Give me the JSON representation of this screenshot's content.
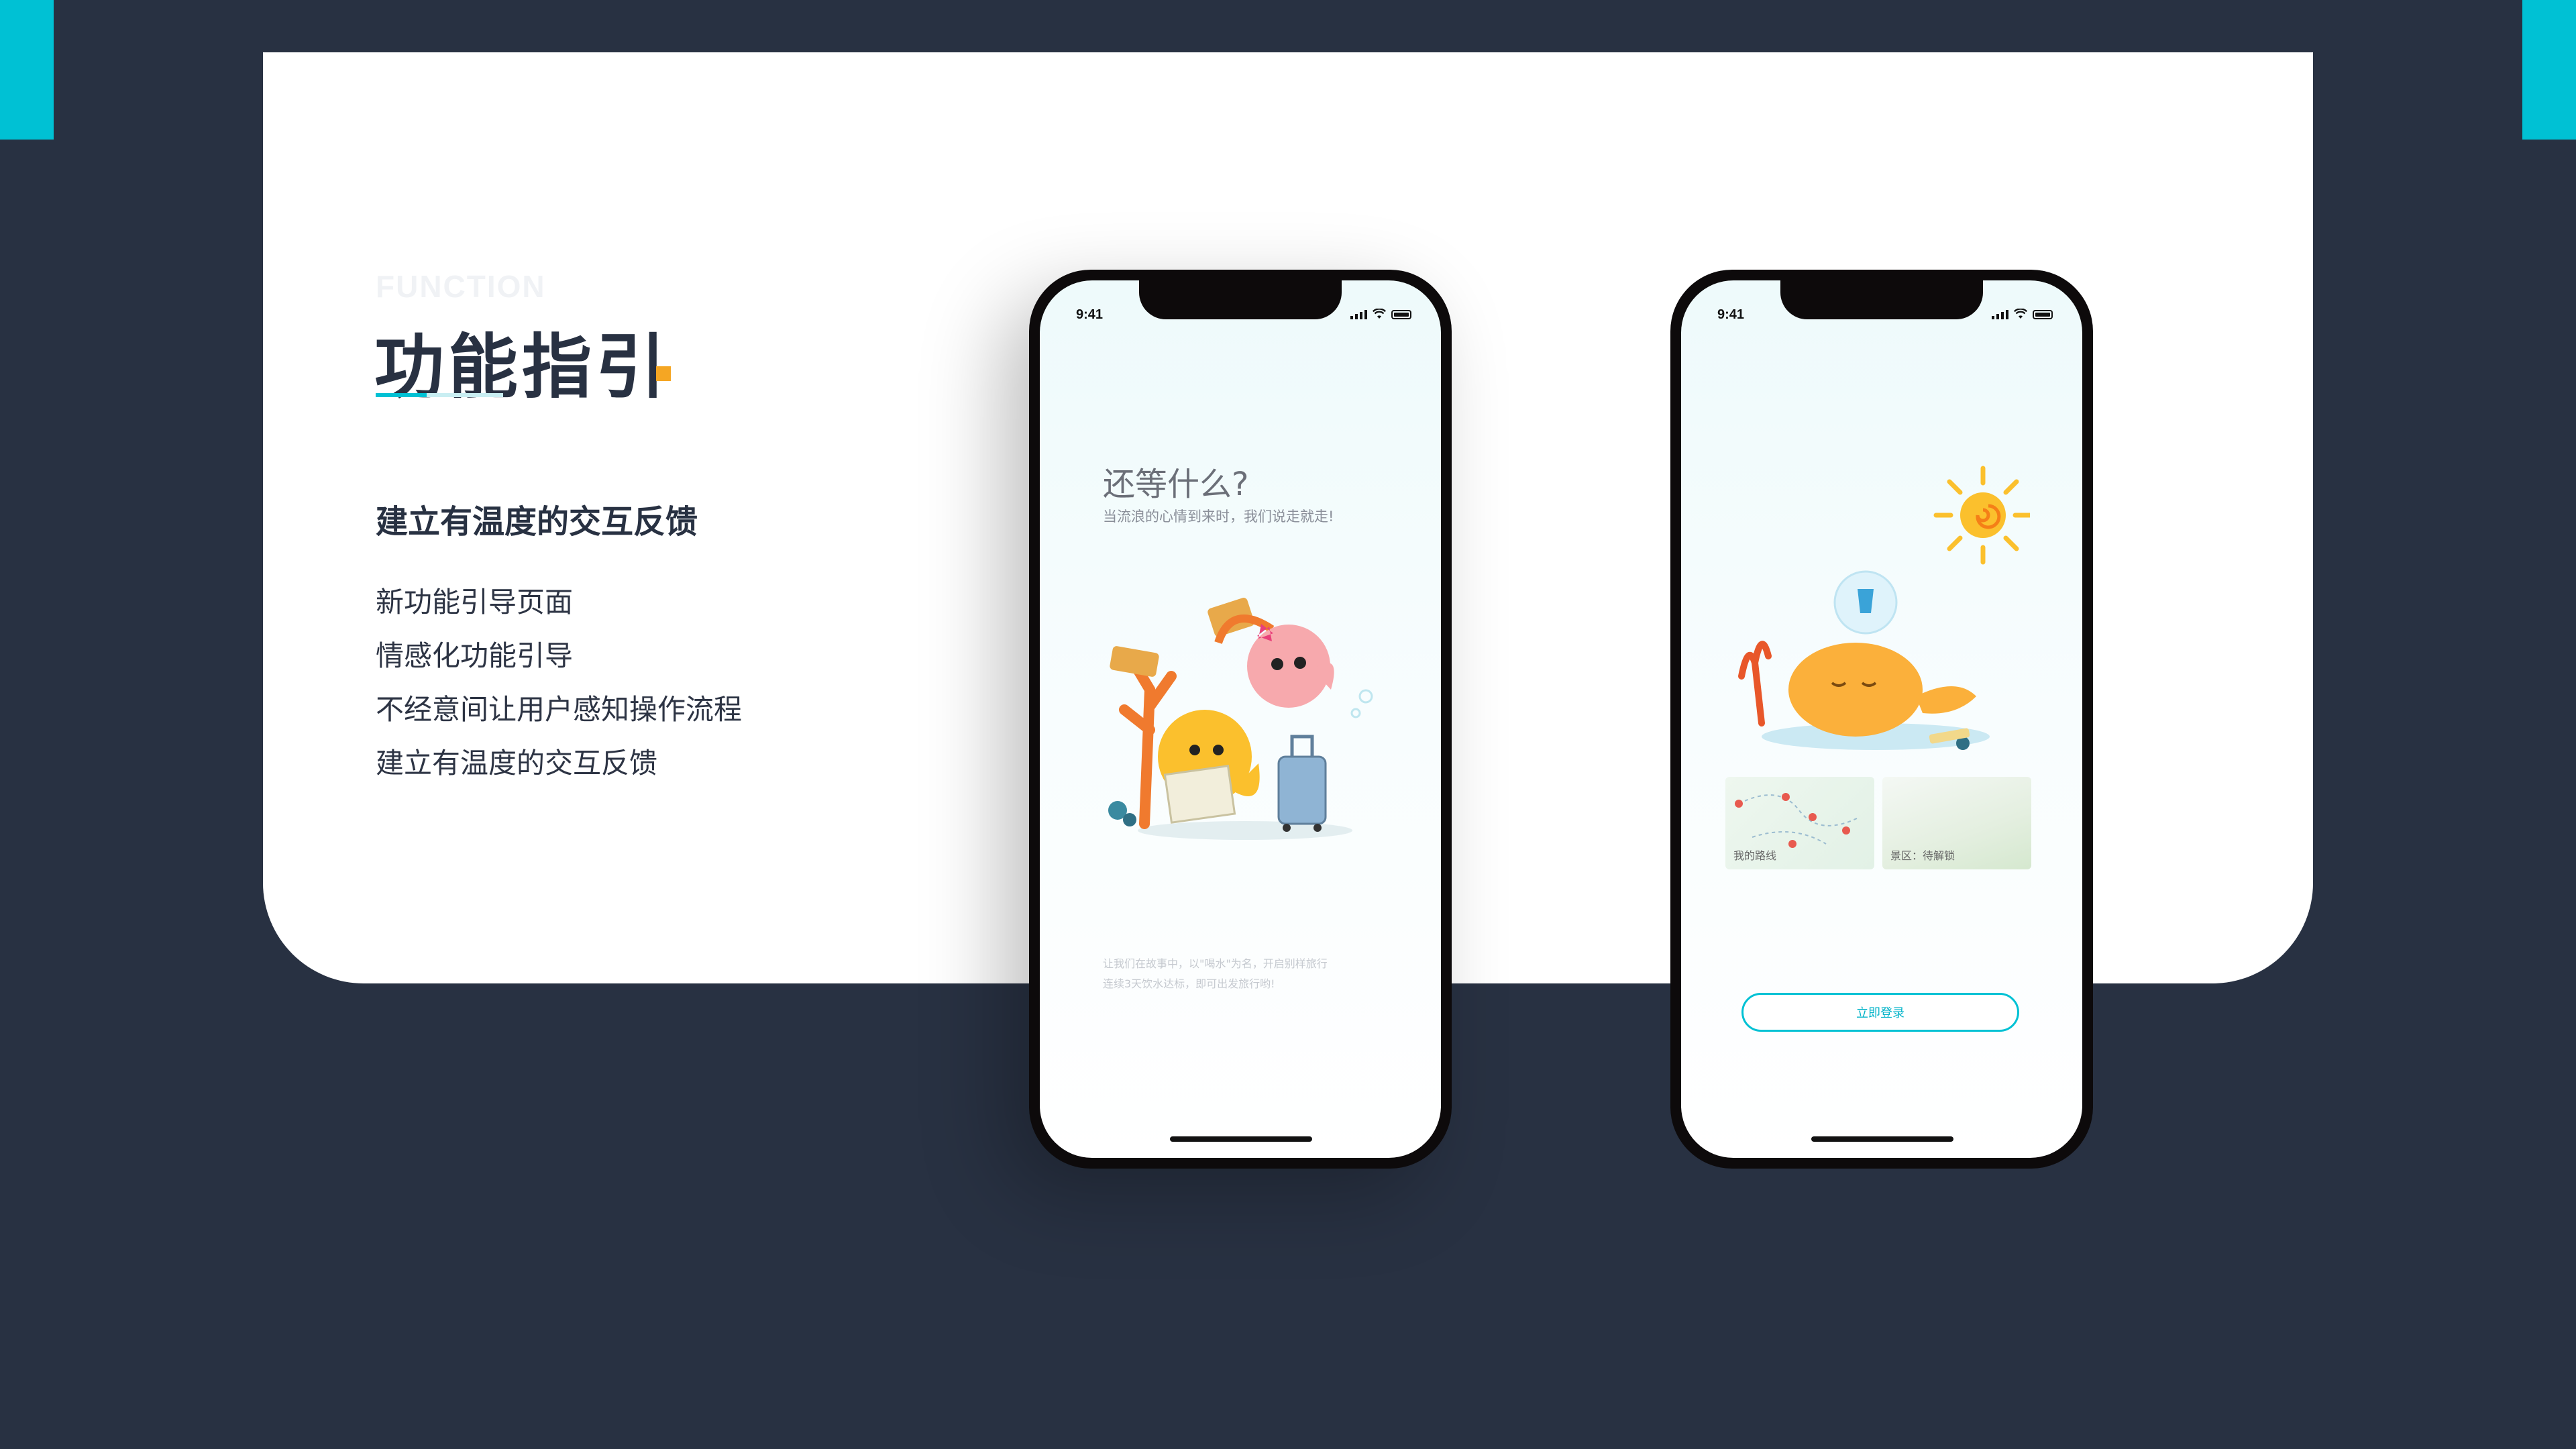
{
  "colors": {
    "background": "#283142",
    "accent": "#00c1d4",
    "dot": "#f5a623"
  },
  "heading": {
    "eyebrow": "FUNCTION",
    "title": "功能指引"
  },
  "section": {
    "subtitle": "建立有温度的交互反馈",
    "features": [
      "新功能引导页面",
      "情感化功能引导",
      "不经意间让用户感知操作流程",
      "建立有温度的交互反馈"
    ]
  },
  "phone1": {
    "time": "9:41",
    "headline": "还等什么?",
    "subline": "当流浪的心情到来时，我们说走就走!",
    "footnote_line1": "让我们在故事中，以\"喝水\"为名，开启别样旅行",
    "footnote_line2": "连续3天饮水达标，即可出发旅行哟!"
  },
  "phone2": {
    "time": "9:41",
    "card_route": "我的路线",
    "card_scenic": "景区：待解锁",
    "login_button": "立即登录"
  }
}
